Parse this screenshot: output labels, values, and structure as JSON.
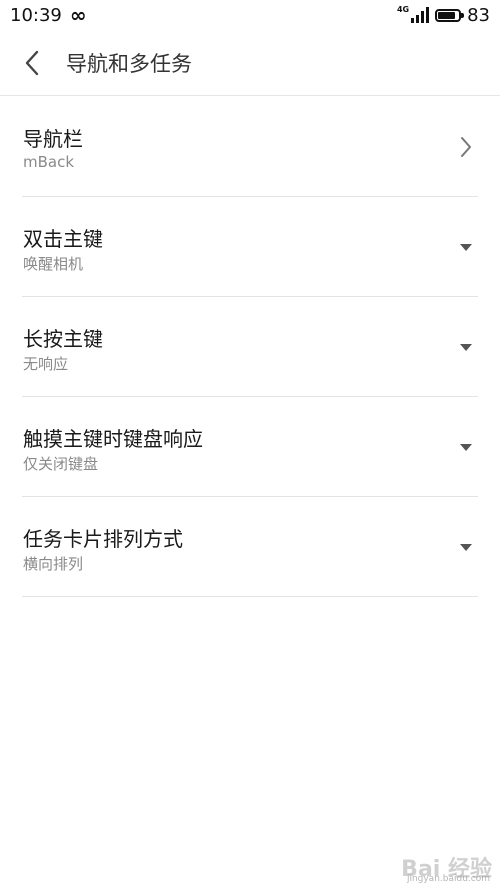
{
  "status_bar": {
    "time": "10:39",
    "network_type": "4G",
    "battery_percent": "83",
    "battery_level": 0.83,
    "icons": [
      "infinity-icon",
      "signal-icon",
      "battery-icon"
    ]
  },
  "header": {
    "back_icon": "chevron-left-icon",
    "title": "导航和多任务"
  },
  "settings": [
    {
      "title": "导航栏",
      "value": "mBack",
      "action_icon": "chevron-right-icon"
    },
    {
      "title": "双击主键",
      "value": "唤醒相机",
      "action_icon": "dropdown-triangle-icon"
    },
    {
      "title": "长按主键",
      "value": "无响应",
      "action_icon": "dropdown-triangle-icon"
    },
    {
      "title": "触摸主键时键盘响应",
      "value": "仅关闭键盘",
      "action_icon": "dropdown-triangle-icon"
    },
    {
      "title": "任务卡片排列方式",
      "value": "横向排列",
      "action_icon": "dropdown-triangle-icon"
    }
  ],
  "watermark": {
    "logo_text": "Bai 经验",
    "url": "jingyan.baidu.com"
  },
  "colors": {
    "text_primary": "#1a1a1a",
    "text_secondary": "#8a8a8a",
    "divider": "#e3e3e3",
    "icon": "#555555"
  }
}
